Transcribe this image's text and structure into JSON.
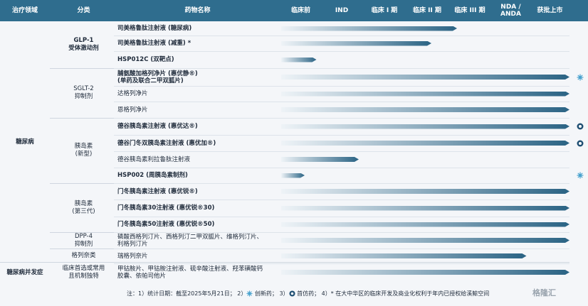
{
  "header": {
    "area": "治疗领域",
    "category": "分类",
    "drug": "药物名称",
    "stages": [
      "临床前",
      "IND",
      "临床 I 期",
      "临床 II 期",
      "临床 III 期",
      "NDA /\nANDA",
      "获批上市"
    ]
  },
  "areas": [
    {
      "label": "糖尿病"
    },
    {
      "label": "糖尿病并发症"
    }
  ],
  "categories": [
    {
      "label": "GLP-1\n受体激动剂",
      "bold": true
    },
    {
      "label": "SGLT-2\n抑制剂",
      "bold": false
    },
    {
      "label": "胰岛素\n(新型)",
      "bold": false
    },
    {
      "label": "胰岛素\n(第三代)",
      "bold": false
    },
    {
      "label": "DPP-4\n抑制剂",
      "bold": false
    },
    {
      "label": "格列奈类",
      "bold": false
    },
    {
      "label": "临床首选或常用\n且机制独特",
      "bold": false
    }
  ],
  "colors": {
    "header": "#2f6d8e",
    "bar_start": "#eef3f7",
    "bar_end": "#2a6384",
    "innovative_icon": "#4aa3cf",
    "first_generic_icon": "#1f4f73"
  },
  "chart_data": {
    "type": "bar",
    "stages": [
      "临床前",
      "IND",
      "临床 I 期",
      "临床 II 期",
      "临床 III 期",
      "NDA / ANDA",
      "获批上市"
    ],
    "drugs": [
      {
        "name": "司美格鲁肽注射液 (糖尿病)",
        "bold": true,
        "progress": 4.2,
        "mark": ""
      },
      {
        "name": "司美格鲁肽注射液 (减重) *",
        "bold": true,
        "progress": 3.6,
        "mark": ""
      },
      {
        "name": "HSP012C (双靶点)",
        "bold": true,
        "progress": 0.9,
        "mark": ""
      },
      {
        "name": "脯氨酸加格列净片 (惠优静®)\n(单药及联合二甲双胍片)",
        "bold": true,
        "progress": 7.0,
        "mark": "innovative"
      },
      {
        "name": "达格列净片",
        "bold": false,
        "progress": 7.0,
        "mark": ""
      },
      {
        "name": "恩格列净片",
        "bold": false,
        "progress": 7.0,
        "mark": ""
      },
      {
        "name": "德谷胰岛素注射液 (惠优达®)",
        "bold": true,
        "progress": 7.0,
        "mark": "first"
      },
      {
        "name": "德谷门冬双胰岛素注射液 (惠优加®)",
        "bold": true,
        "progress": 7.0,
        "mark": "first"
      },
      {
        "name": "德谷胰岛素利拉鲁肽注射液",
        "bold": false,
        "progress": 1.9,
        "mark": ""
      },
      {
        "name": "HSP002 (周胰岛素制剂)",
        "bold": true,
        "progress": 0.6,
        "mark": "innovative"
      },
      {
        "name": "门冬胰岛素注射液 (惠优锐®)",
        "bold": true,
        "progress": 7.0,
        "mark": ""
      },
      {
        "name": "门冬胰岛素30注射液 (惠优锐®30)",
        "bold": true,
        "progress": 7.0,
        "mark": ""
      },
      {
        "name": "门冬胰岛素50注射液 (惠优锐®50)",
        "bold": true,
        "progress": 7.0,
        "mark": ""
      },
      {
        "name": "磷酸西格列汀片、西格列汀二甲双胍片、维格列汀片、\n利格列汀片",
        "bold": false,
        "progress": 7.0,
        "mark": ""
      },
      {
        "name": "瑞格列奈片",
        "bold": false,
        "progress": 5.9,
        "mark": ""
      },
      {
        "name": "甲钴胺片、甲钴胺注射液、硫辛酸注射液、羟苯磺酸钙\n胶囊、依帕司他片",
        "bold": false,
        "progress": 7.0,
        "mark": ""
      }
    ]
  },
  "footnote": {
    "prefix": "注：1）统计日期：截至2025年5月21日；  2）",
    "innovative": " 创新药；   3）",
    "first": " 首仿药；  4）",
    "star": "* 在大中华区的临床开发及商业化权利于年内已授权给溪鲸空间"
  },
  "logo": "格隆汇"
}
